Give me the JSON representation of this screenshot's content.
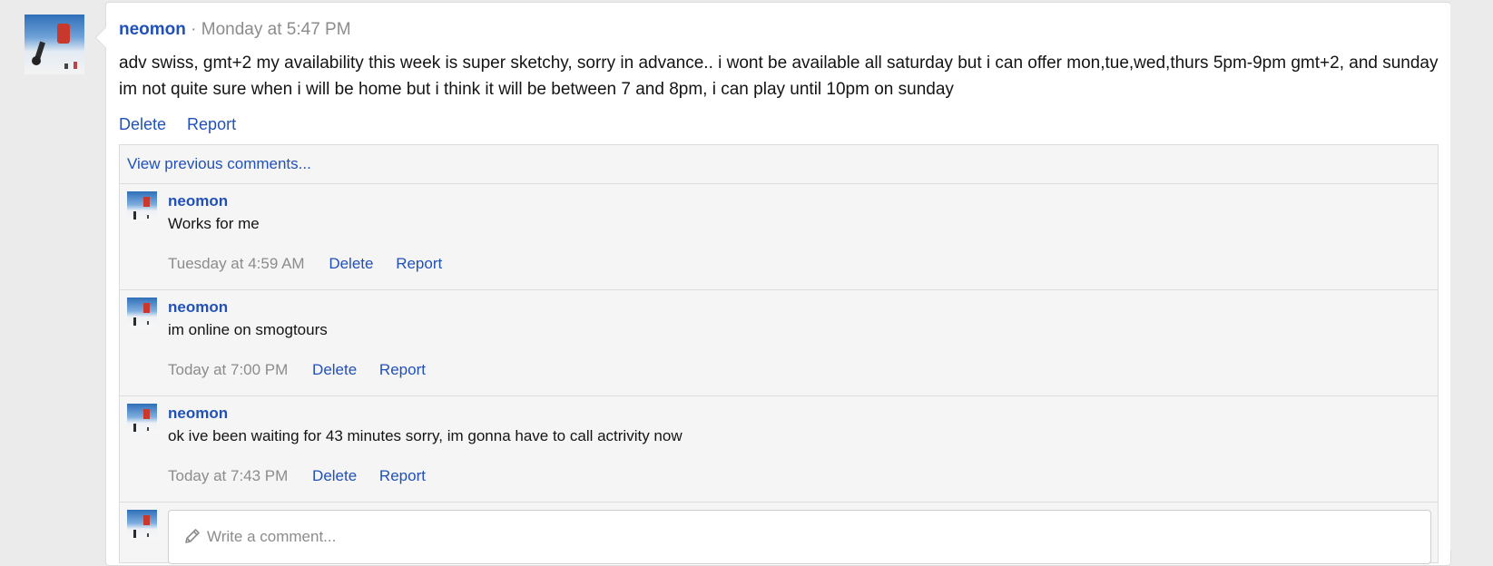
{
  "post": {
    "author": "neomon",
    "separator": " · ",
    "time": "Monday at 5:47 PM",
    "body": "adv swiss, gmt+2 my availability this week is super sketchy, sorry in advance.. i wont be available all saturday but i can offer mon,tue,wed,thurs 5pm-9pm gmt+2, and sunday im not quite sure when i will be home but i think it will be between 7 and 8pm, i can play until 10pm on sunday",
    "actions": {
      "delete": "Delete",
      "report": "Report"
    }
  },
  "comments": {
    "view_previous": "View previous comments...",
    "items": [
      {
        "author": "neomon",
        "text": "Works for me",
        "time": "Tuesday at 4:59 AM",
        "delete": "Delete",
        "report": "Report"
      },
      {
        "author": "neomon",
        "text": "im online on smogtours",
        "time": "Today at 7:00 PM",
        "delete": "Delete",
        "report": "Report"
      },
      {
        "author": "neomon",
        "text": "ok ive been waiting for 43 minutes sorry, im gonna have to call actrivity now",
        "time": "Today at 7:43 PM",
        "delete": "Delete",
        "report": "Report"
      }
    ],
    "write_placeholder": "Write a comment..."
  },
  "colors": {
    "link": "#2151b8",
    "muted": "#8c8c8c",
    "panel": "#f5f5f5"
  },
  "icons": {
    "composer": "pencil-icon"
  }
}
